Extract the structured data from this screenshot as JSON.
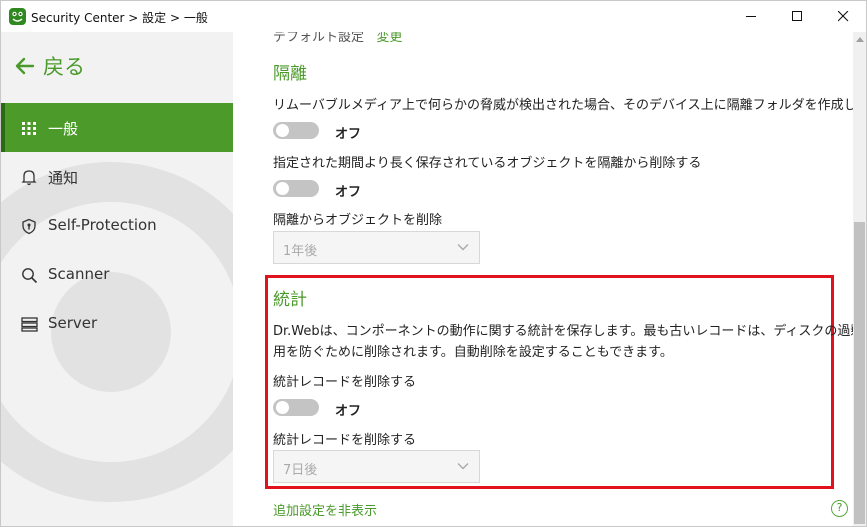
{
  "window": {
    "title": "Security Center > 設定 > 一般"
  },
  "sidebar": {
    "back_label": "戻る",
    "items": [
      {
        "label": "一般",
        "icon": "grid-icon",
        "active": true
      },
      {
        "label": "通知",
        "icon": "bell-icon",
        "active": false
      },
      {
        "label": "Self-Protection",
        "icon": "shield-icon",
        "active": false
      },
      {
        "label": "Scanner",
        "icon": "search-icon",
        "active": false
      },
      {
        "label": "Server",
        "icon": "server-icon",
        "active": false
      }
    ]
  },
  "main": {
    "cut_line": {
      "text": "デフォルト設定",
      "link": "変更"
    },
    "quarantine": {
      "title": "隔離",
      "removable_media_text": "リムーバブルメディア上で何らかの脅威が検出された場合、そのデバイス上に隔離フォルダを作成します",
      "removable_media_toggle": "オフ",
      "delete_old_text": "指定された期間より長く保存されているオブジェクトを隔離から削除する",
      "delete_old_toggle": "オフ",
      "delete_after_label": "隔離からオブジェクトを削除",
      "delete_after_value": "1年後"
    },
    "statistics": {
      "title": "統計",
      "description_line1": "Dr.Webは、コンポーネントの動作に関する統計を保存します。最も古いレコードは、ディスクの過剰使",
      "description_line2": "用を防ぐために削除されます。自動削除を設定することもできます。",
      "delete_records_text": "統計レコードを削除する",
      "delete_records_toggle": "オフ",
      "delete_after_label": "統計レコードを削除する",
      "delete_after_value": "7日後"
    },
    "hide_advanced_link": "追加設定を非表示",
    "help": "?"
  },
  "colors": {
    "accent": "#4c9a2a",
    "highlight": "#e0121d"
  }
}
